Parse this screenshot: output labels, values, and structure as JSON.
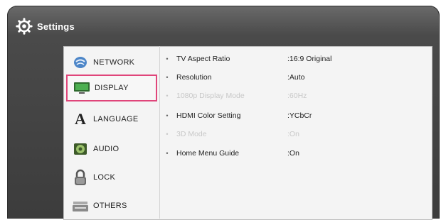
{
  "header": {
    "title": "Settings",
    "icon": "gear-icon"
  },
  "menu": {
    "items": [
      {
        "label": "NETWORK",
        "icon": "network-globe-icon"
      },
      {
        "label": "DISPLAY",
        "icon": "display-monitor-icon",
        "selected": true
      },
      {
        "label": "LANGUAGE",
        "icon": "language-letter-a-icon"
      },
      {
        "label": "AUDIO",
        "icon": "audio-speaker-icon"
      },
      {
        "label": "LOCK",
        "icon": "padlock-icon"
      },
      {
        "label": "OTHERS",
        "icon": "others-tray-icon"
      }
    ],
    "selected_color": "#e0457a"
  },
  "settings": {
    "rows": [
      {
        "name": "TV Aspect Ratio",
        "value": ":16:9 Original",
        "enabled": true
      },
      {
        "name": "Resolution",
        "value": ":Auto",
        "enabled": true
      },
      {
        "name": "1080p Display Mode",
        "value": ":60Hz",
        "enabled": false
      },
      {
        "name": "HDMI Color Setting",
        "value": ":YCbCr",
        "enabled": true
      },
      {
        "name": "3D Mode",
        "value": ":On",
        "enabled": false
      },
      {
        "name": "Home Menu Guide",
        "value": ":On",
        "enabled": true
      }
    ]
  }
}
